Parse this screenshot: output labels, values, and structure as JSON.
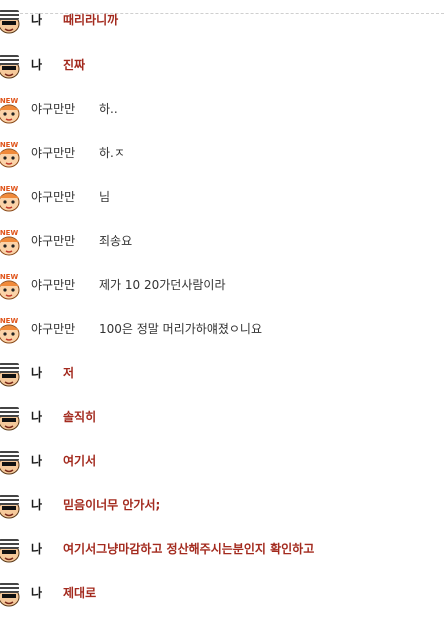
{
  "colors": {
    "my_message": "#a32a1e",
    "other_message": "#333333",
    "new_badge": "#e0541a"
  },
  "avatars": {
    "me": "hat-guy-icon",
    "other": "new-face-icon",
    "new_badge_text": "NEW"
  },
  "messages": [
    {
      "from": "me",
      "sender": "나",
      "text": "때리라니까"
    },
    {
      "from": "me",
      "sender": "나",
      "text": "진짜"
    },
    {
      "from": "other",
      "sender": "야구만만",
      "text": "하.."
    },
    {
      "from": "other",
      "sender": "야구만만",
      "text": "하.ㅈ"
    },
    {
      "from": "other",
      "sender": "야구만만",
      "text": "님"
    },
    {
      "from": "other",
      "sender": "야구만만",
      "text": "죄송요"
    },
    {
      "from": "other",
      "sender": "야구만만",
      "text": "제가 10 20가던사람이라"
    },
    {
      "from": "other",
      "sender": "야구만만",
      "text": "100은 정말 머리가하얘졌ㅇ니요"
    },
    {
      "from": "me",
      "sender": "나",
      "text": "저"
    },
    {
      "from": "me",
      "sender": "나",
      "text": "솔직히"
    },
    {
      "from": "me",
      "sender": "나",
      "text": "여기서"
    },
    {
      "from": "me",
      "sender": "나",
      "text": "믿음이너무 안가서;"
    },
    {
      "from": "me",
      "sender": "나",
      "text": "여기서그냥마감하고 정산해주시는분인지 확인하고"
    },
    {
      "from": "me",
      "sender": "나",
      "text": "제대로"
    }
  ]
}
